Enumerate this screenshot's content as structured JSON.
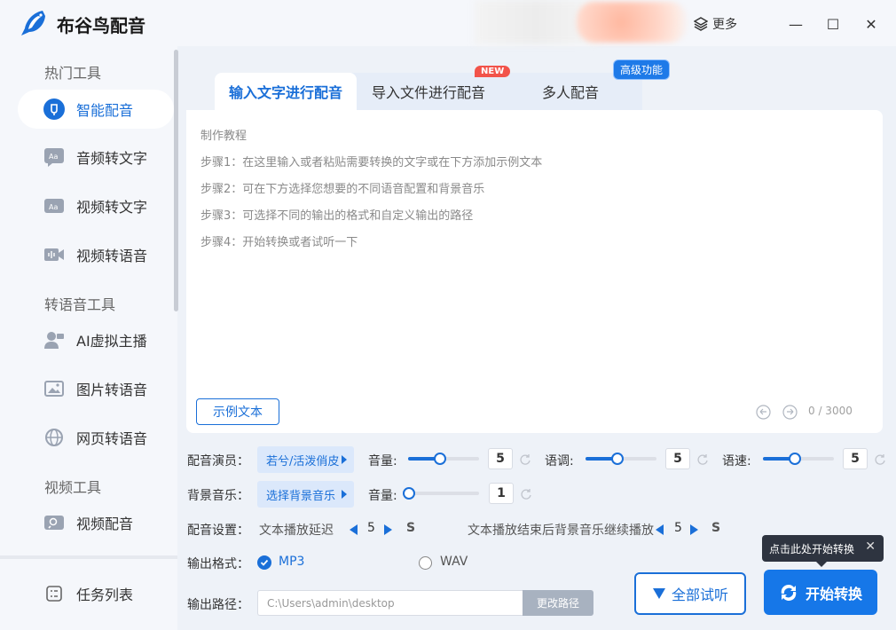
{
  "app": {
    "name": "布谷鸟配音"
  },
  "titlebar": {
    "more_label": "更多",
    "minimize": "—",
    "maximize": "☐",
    "close": "✕"
  },
  "sidebar": {
    "sections": [
      {
        "title": "热门工具"
      },
      {
        "title": "转语音工具"
      },
      {
        "title": "视频工具"
      }
    ],
    "items": [
      {
        "label": "智能配音",
        "icon": "smart-dubbing-icon",
        "active": true
      },
      {
        "label": "音频转文字",
        "icon": "audio-to-text-icon"
      },
      {
        "label": "视频转文字",
        "icon": "video-to-text-icon"
      },
      {
        "label": "视频转语音",
        "icon": "video-to-speech-icon"
      },
      {
        "label": "AI虚拟主播",
        "icon": "ai-anchor-icon"
      },
      {
        "label": "图片转语音",
        "icon": "image-to-speech-icon"
      },
      {
        "label": "网页转语音",
        "icon": "web-to-speech-icon"
      },
      {
        "label": "视频配音",
        "icon": "video-dubbing-icon"
      }
    ],
    "task_list": "任务列表"
  },
  "tabs": {
    "items": [
      {
        "label": "输入文字进行配音",
        "active": true
      },
      {
        "label": "导入文件进行配音",
        "badge": "NEW"
      },
      {
        "label": "多人配音",
        "badge": "高级功能"
      }
    ]
  },
  "editor": {
    "heading": "制作教程",
    "steps": [
      "步骤1：在这里输入或者粘贴需要转换的文字或在下方添加示例文本",
      "步骤2：可在下方选择您想要的不同语音配置和背景音乐",
      "步骤3：可选择不同的输出的格式和自定义输出的路径",
      "步骤4：开始转换或者试听一下"
    ],
    "sample_button": "示例文本",
    "char_count": "0 / 3000"
  },
  "voice": {
    "label": "配音演员：",
    "selected": "若兮/活泼俏皮",
    "volume_label": "音量:",
    "volume": 5,
    "pitch_label": "语调:",
    "pitch": 5,
    "speed_label": "语速:",
    "speed": 5,
    "slider_fraction": 0.45
  },
  "bgm": {
    "label": "背景音乐：",
    "selected": "选择背景音乐",
    "volume_label": "音量:",
    "volume": 1,
    "slider_fraction": 0.0
  },
  "settings": {
    "label": "配音设置：",
    "delay_label": "文本播放延迟",
    "delay": 5,
    "delay_unit": "S",
    "continue_label": "文本播放结束后背景音乐继续播放",
    "continue": 5,
    "continue_unit": "S"
  },
  "output": {
    "format_label": "输出格式：",
    "formats": [
      {
        "label": "MP3",
        "selected": true
      },
      {
        "label": "WAV",
        "selected": false
      }
    ],
    "path_label": "输出路径：",
    "path": "C:\\Users\\admin\\desktop",
    "change_path": "更改路径"
  },
  "actions": {
    "listen_all": "全部试听",
    "start": "开始转换",
    "tooltip": "点击此处开始转换",
    "tooltip_close": "✕"
  },
  "colors": {
    "accent": "#1a6fd8",
    "start_button": "#1677e8",
    "new_badge": "#f2534a"
  }
}
